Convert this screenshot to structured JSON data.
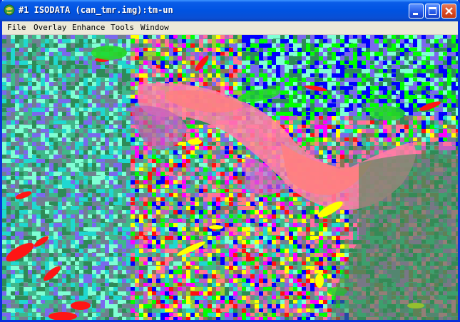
{
  "window": {
    "title": "#1 ISODATA (can_tmr.img):tm-un",
    "icon": "globe-icon",
    "controls": [
      "minimize",
      "maximize",
      "close"
    ]
  },
  "menu": [
    {
      "label": "File"
    },
    {
      "label": "Overlay"
    },
    {
      "label": "Enhance"
    },
    {
      "label": "Tools"
    },
    {
      "label": "Window"
    }
  ],
  "image": {
    "content": "classified raster (ISODATA clustering)",
    "class_colors": [
      "#3fb88a",
      "#2e8b57",
      "#1fd8d0",
      "#7fffd4",
      "#7b68ee",
      "#c060c0",
      "#ff6fa0",
      "#ff7f7f",
      "#ff1010",
      "#ff00ff",
      "#00ff00",
      "#9acd32",
      "#ffff00",
      "#0000ff",
      "#708090",
      "#8b7355"
    ]
  }
}
